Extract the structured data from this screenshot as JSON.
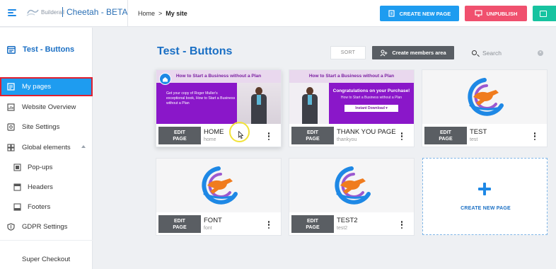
{
  "header": {
    "logo_text": "Builderall",
    "app_title": "Cheetah - BETA",
    "breadcrumb": {
      "home": "Home",
      "separator": ">",
      "current": "My site"
    },
    "create_page_label": "CREATE NEW PAGE",
    "unpublish_label": "UNPUBLISH",
    "colors": {
      "create": "#1e9cf0",
      "unpublish": "#f0506e",
      "extra": "#17c3a0"
    }
  },
  "sidebar": {
    "site_name": "Test - Buttons",
    "items": [
      {
        "label": "My pages",
        "icon": "pages-icon",
        "active": true
      },
      {
        "label": "Website Overview",
        "icon": "chart-icon"
      },
      {
        "label": "Site Settings",
        "icon": "settings-icon"
      },
      {
        "label": "Global elements",
        "icon": "globe-icon",
        "expanded": true
      },
      {
        "label": "Pop-ups",
        "icon": "popup-icon",
        "sub": true
      },
      {
        "label": "Headers",
        "icon": "header-icon",
        "sub": true
      },
      {
        "label": "Footers",
        "icon": "footer-icon",
        "sub": true
      },
      {
        "label": "GDPR Settings",
        "icon": "shield-icon"
      },
      {
        "label": "Super Checkout",
        "icon": "checkout-icon"
      }
    ]
  },
  "main": {
    "title": "Test - Buttons",
    "sort_label": "SORT",
    "members_label": "Create members area",
    "search_placeholder": "Search",
    "edit_label_line1": "EDIT",
    "edit_label_line2": "PAGE",
    "new_page_label": "CREATE NEW PAGE",
    "pages": [
      {
        "name": "HOME",
        "slug": "home",
        "thumb": "sales",
        "is_home": true,
        "thumb_text": {
          "headline": "How to Start a Business without a Plan",
          "body": "Get your copy of Roger Muller's exceptional book, How to Start a Business without a Plan"
        }
      },
      {
        "name": "THANK YOU PAGE",
        "slug": "thankyou",
        "thumb": "thankyou",
        "thumb_text": {
          "headline": "How to Start a Business without a Plan",
          "big": "Congratulations on your Purchase!",
          "small": "How to Start a Business without a Plan",
          "button": "Instant Download ▾"
        }
      },
      {
        "name": "TEST",
        "slug": "test",
        "thumb": "logo"
      },
      {
        "name": "FONT",
        "slug": "font",
        "thumb": "logo"
      },
      {
        "name": "TEST2",
        "slug": "test2",
        "thumb": "logo"
      }
    ]
  }
}
